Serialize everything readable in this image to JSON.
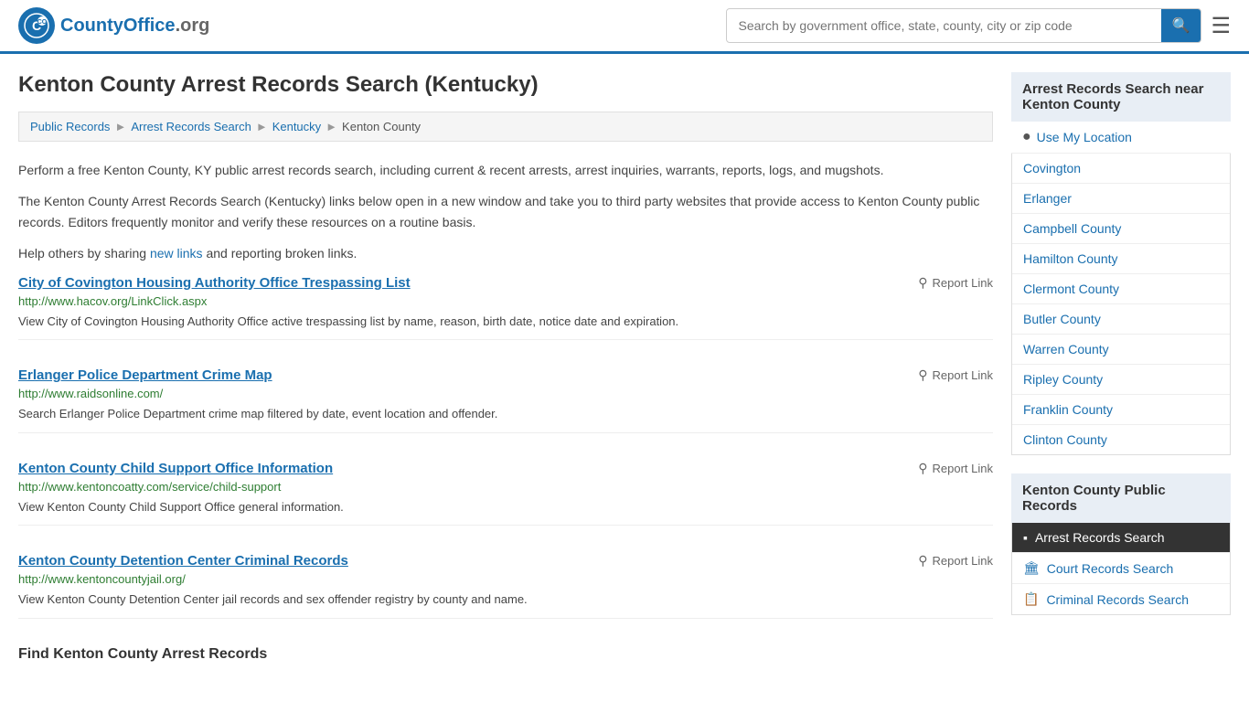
{
  "header": {
    "logo_text": "CountyOffice",
    "logo_suffix": ".org",
    "search_placeholder": "Search by government office, state, county, city or zip code",
    "search_value": ""
  },
  "page": {
    "title": "Kenton County Arrest Records Search (Kentucky)",
    "breadcrumbs": [
      {
        "label": "Public Records",
        "href": "#"
      },
      {
        "label": "Arrest Records Search",
        "href": "#"
      },
      {
        "label": "Kentucky",
        "href": "#"
      },
      {
        "label": "Kenton County",
        "href": "#"
      }
    ],
    "description1": "Perform a free Kenton County, KY public arrest records search, including current & recent arrests, arrest inquiries, warrants, reports, logs, and mugshots.",
    "description2": "The Kenton County Arrest Records Search (Kentucky) links below open in a new window and take you to third party websites that provide access to Kenton County public records. Editors frequently monitor and verify these resources on a routine basis.",
    "description3_pre": "Help others by sharing ",
    "description3_link": "new links",
    "description3_post": " and reporting broken links.",
    "resources": [
      {
        "title": "City of Covington Housing Authority Office Trespassing List",
        "url": "http://www.hacov.org/LinkClick.aspx",
        "description": "View City of Covington Housing Authority Office active trespassing list by name, reason, birth date, notice date and expiration.",
        "report_label": "Report Link"
      },
      {
        "title": "Erlanger Police Department Crime Map",
        "url": "http://www.raidsonline.com/",
        "description": "Search Erlanger Police Department crime map filtered by date, event location and offender.",
        "report_label": "Report Link"
      },
      {
        "title": "Kenton County Child Support Office Information",
        "url": "http://www.kentoncoatty.com/service/child-support",
        "description": "View Kenton County Child Support Office general information.",
        "report_label": "Report Link"
      },
      {
        "title": "Kenton County Detention Center Criminal Records",
        "url": "http://www.kentoncountyjail.org/",
        "description": "View Kenton County Detention Center jail records and sex offender registry by county and name.",
        "report_label": "Report Link"
      }
    ],
    "find_section_title": "Find Kenton County Arrest Records"
  },
  "sidebar": {
    "nearby_header": "Arrest Records Search near Kenton County",
    "use_location_label": "Use My Location",
    "nearby_links": [
      {
        "label": "Covington"
      },
      {
        "label": "Erlanger"
      },
      {
        "label": "Campbell County"
      },
      {
        "label": "Hamilton County"
      },
      {
        "label": "Clermont County"
      },
      {
        "label": "Butler County"
      },
      {
        "label": "Warren County"
      },
      {
        "label": "Ripley County"
      },
      {
        "label": "Franklin County"
      },
      {
        "label": "Clinton County"
      }
    ],
    "public_records_header": "Kenton County Public Records",
    "public_records": [
      {
        "label": "Arrest Records Search",
        "icon": "▪",
        "active": true
      },
      {
        "label": "Court Records Search",
        "icon": "🏛"
      },
      {
        "label": "Criminal Records Search",
        "icon": "📋"
      }
    ]
  }
}
